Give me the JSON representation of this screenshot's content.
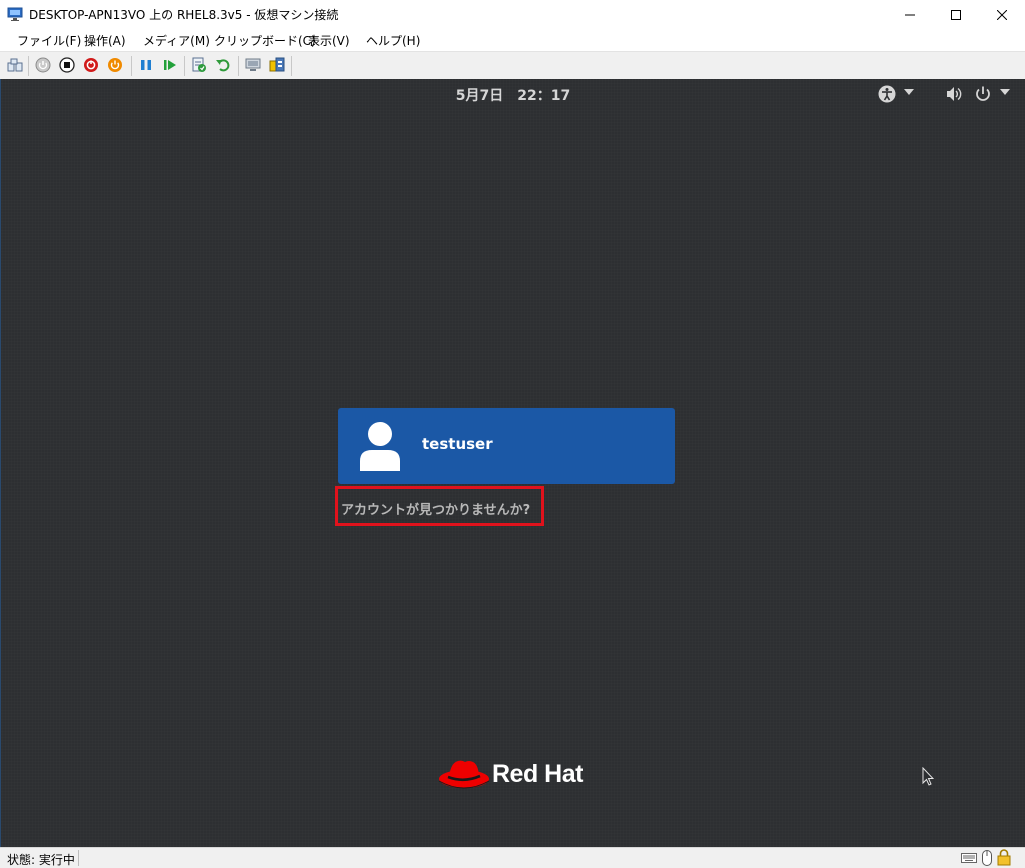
{
  "window": {
    "title": "DESKTOP-APN13VO 上の RHEL8.3v5 - 仮想マシン接続",
    "icon": "vm-connect-icon",
    "controls": [
      "minimize-icon",
      "maximize-icon",
      "close-icon"
    ]
  },
  "menu": {
    "items": [
      {
        "label": "ファイル(F)"
      },
      {
        "label": "操作(A)"
      },
      {
        "label": "メディア(M)"
      },
      {
        "label": "クリップボード(C)"
      },
      {
        "label": "表示(V)"
      },
      {
        "label": "ヘルプ(H)"
      }
    ]
  },
  "toolbar": {
    "icons": [
      "ctrl-alt-del-icon",
      "start-icon",
      "turn-off-icon",
      "shut-down-icon",
      "save-icon",
      "pause-icon",
      "resume-icon",
      "checkpoint-icon",
      "revert-icon",
      "enhanced-session-icon",
      "share-icon"
    ]
  },
  "guest": {
    "clock": "5月7日　22：17",
    "top_right_icons": [
      "accessibility-icon",
      "dropdown-arrow-icon",
      "volume-icon",
      "power-icon",
      "dropdown-arrow-icon"
    ],
    "user": {
      "name": "testuser"
    },
    "not_listed": "アカウントが見つかりませんか?",
    "brand": "Red Hat",
    "colors": {
      "card": "#1b58a6",
      "highlight": "#e0121c",
      "brand_red": "#ee0000"
    }
  },
  "status": {
    "label": "状態: 実行中",
    "icons": [
      "keyboard-icon",
      "mouse-icon",
      "lock-icon"
    ]
  }
}
